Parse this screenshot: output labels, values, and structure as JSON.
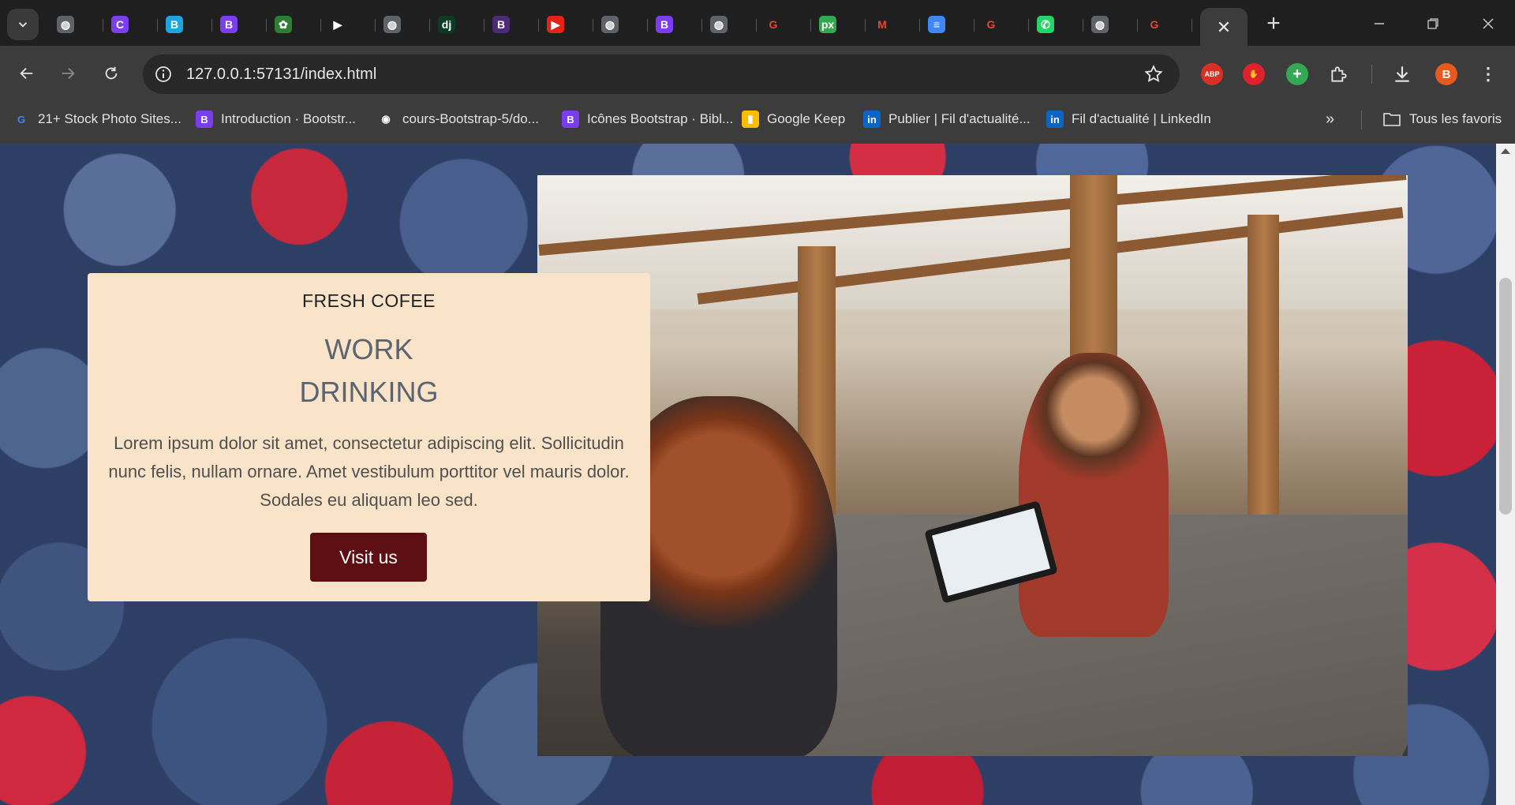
{
  "tabs": [
    {
      "icon": "globe-icon",
      "color": "#5f6368",
      "glyph": "◍"
    },
    {
      "icon": "c-icon",
      "color": "#7b3ff2",
      "glyph": "C"
    },
    {
      "icon": "bootstrap-icon",
      "color": "#1ea5e0",
      "glyph": "B"
    },
    {
      "icon": "bootstrap-icon",
      "color": "#7a3ef0",
      "glyph": "B"
    },
    {
      "icon": "leaf-icon",
      "color": "#2e7d32",
      "glyph": "✿"
    },
    {
      "icon": "play-icon",
      "color": "#1f1f1f",
      "glyph": "▶"
    },
    {
      "icon": "globe-icon",
      "color": "#5f6368",
      "glyph": "◍"
    },
    {
      "icon": "django-icon",
      "color": "#0c3c26",
      "glyph": "dj"
    },
    {
      "icon": "bootstrap-icon",
      "color": "#4b2a7a",
      "glyph": "B"
    },
    {
      "icon": "youtube-icon",
      "color": "#e62117",
      "glyph": "▶"
    },
    {
      "icon": "globe-icon",
      "color": "#5f6368",
      "glyph": "◍"
    },
    {
      "icon": "bootstrap-icon",
      "color": "#7a3ef0",
      "glyph": "B"
    },
    {
      "icon": "globe-icon",
      "color": "#5f6368",
      "glyph": "◍"
    },
    {
      "icon": "google-icon",
      "color": "#ffffff",
      "glyph": "G"
    },
    {
      "icon": "px-icon",
      "color": "#33a853",
      "glyph": "px"
    },
    {
      "icon": "gmail-icon",
      "color": "#ffffff",
      "glyph": "M"
    },
    {
      "icon": "docs-icon",
      "color": "#4285f4",
      "glyph": "≡"
    },
    {
      "icon": "google-icon",
      "color": "#ffffff",
      "glyph": "G"
    },
    {
      "icon": "whatsapp-icon",
      "color": "#25d366",
      "glyph": "✆"
    },
    {
      "icon": "globe-icon",
      "color": "#5f6368",
      "glyph": "◍"
    },
    {
      "icon": "google-icon",
      "color": "#ffffff",
      "glyph": "G"
    }
  ],
  "toolbar": {
    "url": "127.0.0.1:57131/index.html",
    "profile_initial": "B",
    "abp_label": "ABP"
  },
  "bookmarks": [
    {
      "label": "21+ Stock Photo Sites...",
      "icon": "google-icon",
      "color": "#ffffff",
      "glyph": "G"
    },
    {
      "label": "Introduction · Bootstr...",
      "icon": "bootstrap-icon",
      "color": "#7a3ef0",
      "glyph": "B"
    },
    {
      "label": "cours-Bootstrap-5/do...",
      "icon": "github-icon",
      "color": "#ffffff",
      "glyph": "◉"
    },
    {
      "label": "Icônes Bootstrap · Bibl...",
      "icon": "bootstrap-icon",
      "color": "#7a3ef0",
      "glyph": "B"
    },
    {
      "label": "Google Keep",
      "icon": "keep-icon",
      "color": "#fbbc04",
      "glyph": "▮"
    },
    {
      "label": "Publier | Fil d'actualité...",
      "icon": "linkedin-icon",
      "color": "#0a66c2",
      "glyph": "in"
    },
    {
      "label": "Fil d'actualité | LinkedIn",
      "icon": "linkedin-icon",
      "color": "#0a66c2",
      "glyph": "in"
    }
  ],
  "all_bookmarks_label": "Tous les favoris",
  "card": {
    "kicker": "FRESH COFEE",
    "title_line1": "WORK",
    "title_line2": "DRINKING",
    "body": "Lorem ipsum dolor sit amet, consectetur adipiscing elit. Sollicitudin nunc felis, nullam ornare. Amet vestibulum porttitor vel mauris dolor. Sodales eu aliquam leo sed.",
    "button": "Visit us"
  },
  "colors": {
    "card_bg": "#f9e3c9",
    "button_bg": "#5e0f14"
  }
}
